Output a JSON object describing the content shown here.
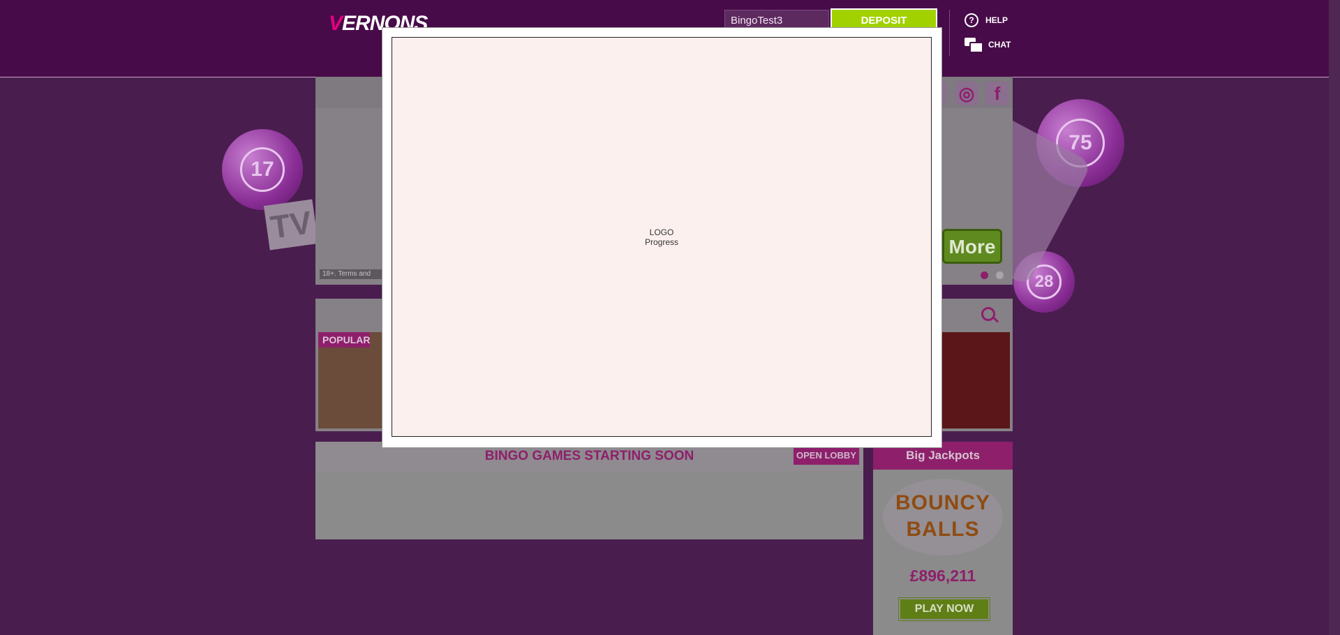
{
  "header": {
    "logo_text_v": "V",
    "logo_text_rest": "ERNONS",
    "username": "BingoTest3",
    "deposit_label": "DEPOSIT",
    "help_label": "HELP",
    "chat_label": "CHAT",
    "help_glyph": "?"
  },
  "hero": {
    "terms_text": "18+. Terms and",
    "more_label": "More",
    "balls": [
      "17",
      "75",
      "28"
    ],
    "tv_text": "TV"
  },
  "games": {
    "popular_badge": "POPULAR"
  },
  "bingo": {
    "title": "BINGO GAMES STARTING SOON",
    "open_lobby_label": "OPEN LOBBY"
  },
  "jackpots": {
    "title": "Big Jackpots",
    "game_logo": "BOUNCY BALLS",
    "amount": "£896,211",
    "play_now_label": "PLAY NOW"
  },
  "modal": {
    "placeholder_line1": "LOGO",
    "placeholder_line2": "Progress",
    "close_glyph": "×"
  },
  "colors": {
    "header_bg": "#480b49",
    "brand_pink": "#e6007e",
    "deposit_green": "#a2d100",
    "modal_bg": "#fcf0ef"
  }
}
